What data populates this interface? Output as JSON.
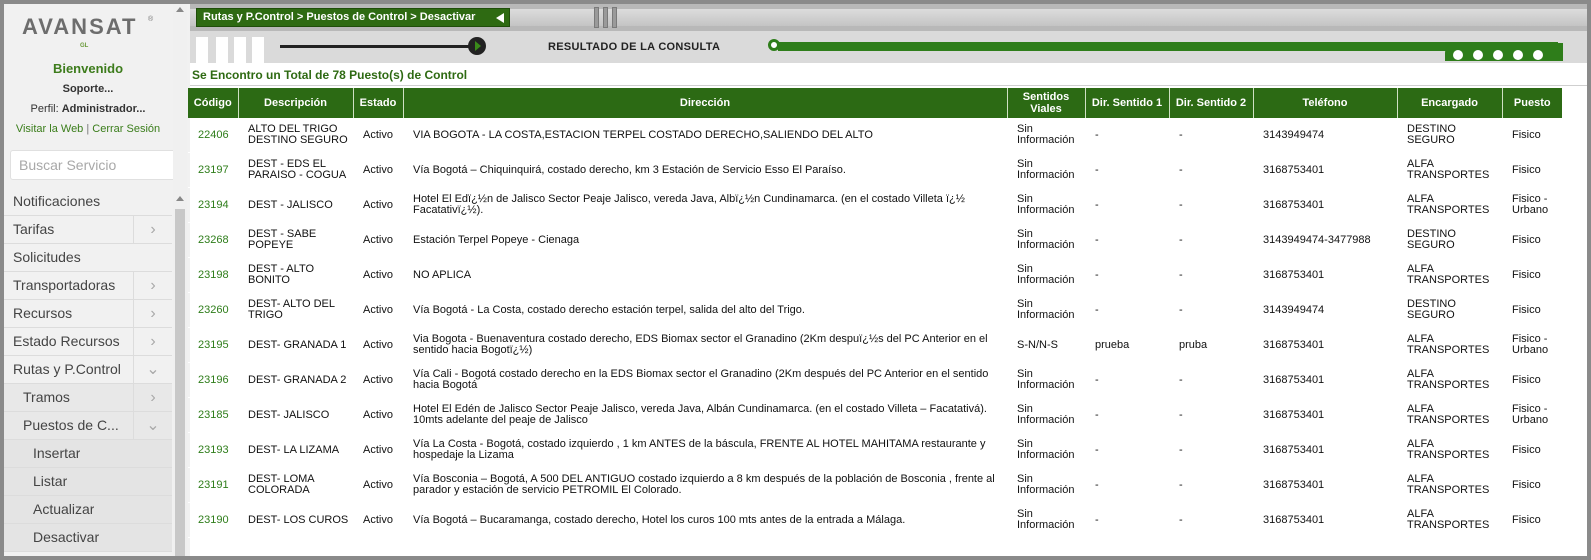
{
  "sidebar": {
    "logo": "AVANSAT",
    "logo_reg": "®",
    "logo_sub": "GL",
    "welcome": "Bienvenido",
    "user": "Soporte...",
    "profile_label": "Perfil:",
    "profile_value": "Administrador...",
    "link_web": "Visitar la Web",
    "link_sep": "|",
    "link_logout": "Cerrar Sesión",
    "search_placeholder": "Buscar Servicio",
    "menu": [
      {
        "label": "Notificaciones",
        "arrow": "",
        "level": 1
      },
      {
        "label": "Tarifas",
        "arrow": "›",
        "level": 1
      },
      {
        "label": "Solicitudes",
        "arrow": "",
        "level": 1
      },
      {
        "label": "Transportadoras",
        "arrow": "›",
        "level": 1
      },
      {
        "label": "Recursos",
        "arrow": "›",
        "level": 1
      },
      {
        "label": "Estado Recursos",
        "arrow": "›",
        "level": 1
      },
      {
        "label": "Rutas y P.Control",
        "arrow": "⌄",
        "level": 1
      },
      {
        "label": "Tramos",
        "arrow": "›",
        "level": 2
      },
      {
        "label": "Puestos de C...",
        "arrow": "⌄",
        "level": 2
      },
      {
        "label": "Insertar",
        "arrow": "",
        "level": 3
      },
      {
        "label": "Listar",
        "arrow": "",
        "level": 3
      },
      {
        "label": "Actualizar",
        "arrow": "",
        "level": 3
      },
      {
        "label": "Desactivar",
        "arrow": "",
        "level": 3
      }
    ]
  },
  "header": {
    "breadcrumb": "Rutas y P.Control > Puestos de Control > Desactivar",
    "result_title": "RESULTADO DE LA CONSULTA"
  },
  "count_text": "Se Encontro un Total de 78 Puesto(s) de Control",
  "table": {
    "columns": [
      "Código",
      "Descripción",
      "Estado",
      "Dirección",
      "Sentidos Viales",
      "Dir. Sentido 1",
      "Dir. Sentido 2",
      "Teléfono",
      "Encargado",
      "Puesto"
    ],
    "rows": [
      [
        "22406",
        "ALTO DEL TRIGO DESTINO SEGURO",
        "Activo",
        "VIA BOGOTA - LA COSTA,ESTACION TERPEL COSTADO DERECHO,SALIENDO DEL ALTO",
        "Sin Información",
        "-",
        "-",
        "3143949474",
        "DESTINO SEGURO",
        "Fisico"
      ],
      [
        "23197",
        "DEST - EDS EL PARAISO - COGUA",
        "Activo",
        "Vía Bogotá – Chiquinquirá, costado derecho, km 3 Estación de Servicio Esso El Paraíso.",
        "Sin Información",
        "-",
        "-",
        "3168753401",
        "ALFA TRANSPORTES",
        "Fisico"
      ],
      [
        "23194",
        "DEST - JALISCO",
        "Activo",
        "Hotel El Edï¿½n de Jalisco Sector Peaje Jalisco, vereda Java, Albï¿½n Cundinamarca. (en el costado Villeta ï¿½ Facatativï¿½).",
        "Sin Información",
        "-",
        "-",
        "3168753401",
        "ALFA TRANSPORTES",
        "Fisico - Urbano"
      ],
      [
        "23268",
        "DEST - SABE POPEYE",
        "Activo",
        "Estación Terpel Popeye - Cienaga",
        "Sin Información",
        "-",
        "-",
        "3143949474-3477988",
        "DESTINO SEGURO",
        "Fisico"
      ],
      [
        "23198",
        "DEST - ALTO BONITO",
        "Activo",
        "NO APLICA",
        "Sin Información",
        "-",
        "-",
        "3168753401",
        "ALFA TRANSPORTES",
        "Fisico"
      ],
      [
        "23260",
        "DEST- ALTO DEL TRIGO",
        "Activo",
        "Vía Bogotá - La Costa, costado derecho estación terpel, salida del alto del Trigo.",
        "Sin Información",
        "-",
        "-",
        "3143949474",
        "DESTINO SEGURO",
        "Fisico"
      ],
      [
        "23195",
        "DEST- GRANADA 1",
        "Activo",
        "Via Bogota - Buenaventura costado derecho, EDS Biomax sector el Granadino (2Km despuï¿½s del PC Anterior en el sentido hacia Bogotï¿½)",
        "S-N/N-S",
        "prueba",
        "pruba",
        "3168753401",
        "ALFA TRANSPORTES",
        "Fisico - Urbano"
      ],
      [
        "23196",
        "DEST- GRANADA 2",
        "Activo",
        "Vía Cali - Bogotá costado derecho en la EDS Biomax sector el Granadino (2Km después del PC Anterior en el sentido hacia Bogotá",
        "Sin Información",
        "-",
        "-",
        "3168753401",
        "ALFA TRANSPORTES",
        "Fisico"
      ],
      [
        "23185",
        "DEST- JALISCO",
        "Activo",
        "Hotel El Edén de Jalisco Sector Peaje Jalisco, vereda Java, Albán Cundinamarca. (en el costado Villeta – Facatativá). 10mts adelante del peaje de Jalisco",
        "Sin Información",
        "-",
        "-",
        "3168753401",
        "ALFA TRANSPORTES",
        "Fisico - Urbano"
      ],
      [
        "23193",
        "DEST- LA LIZAMA",
        "Activo",
        "Vía La Costa - Bogotá, costado izquierdo , 1 km ANTES de la báscula, FRENTE AL HOTEL MAHITAMA restaurante y hospedaje la Lizama",
        "Sin Información",
        "-",
        "-",
        "3168753401",
        "ALFA TRANSPORTES",
        "Fisico"
      ],
      [
        "23191",
        "DEST- LOMA COLORADA",
        "Activo",
        "Vía Bosconia – Bogotá, A 500 DEL ANTIGUO costado izquierdo a 8 km después de la población de Bosconia , frente al parador y estación de servicio PETROMIL El Colorado.",
        "Sin Información",
        "-",
        "-",
        "3168753401",
        "ALFA TRANSPORTES",
        "Fisico"
      ],
      [
        "23190",
        "DEST- LOS CUROS",
        "Activo",
        "Vía Bogotá – Bucaramanga, costado derecho, Hotel los curos 100 mts antes de la entrada a Málaga.",
        "Sin Información",
        "-",
        "-",
        "3168753401",
        "ALFA TRANSPORTES",
        "Fisico"
      ]
    ]
  }
}
